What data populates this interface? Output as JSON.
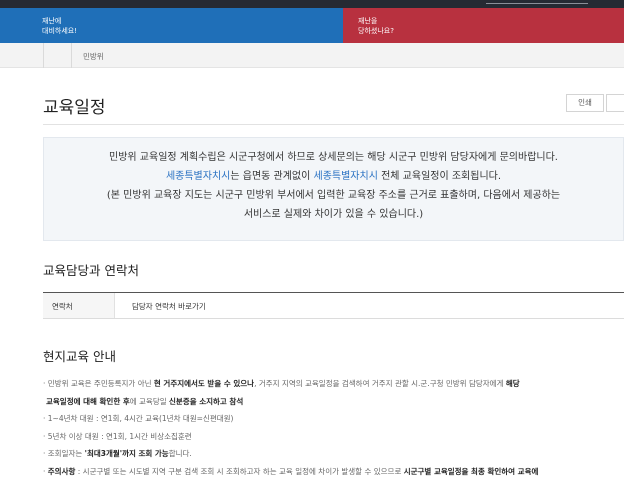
{
  "top_banners": {
    "left": {
      "line1": "재난에",
      "line2": "대비하세요!"
    },
    "right": {
      "line1": "재난을",
      "line2": "당하셨나요?"
    }
  },
  "breadcrumb": {
    "current": "민방위"
  },
  "page": {
    "title": "교육일정",
    "print_label": "인쇄"
  },
  "notice": {
    "line1": "민방위 교육일정 계획수립은 시군구청에서 하므로 상세문의는 해당 시군구 민방위 담당자에게 문의바랍니다.",
    "line2_part1": "세종특별자치시",
    "line2_part2": "는 읍면동 관계없이 ",
    "line2_part3": "세종특별자치시",
    "line2_part4": " 전체 교육일정이 조회됩니다.",
    "line3": "(본 민방위 교육장 지도는 시군구 민방위 부서에서 입력한 교육장 주소를 근거로 표출하며, 다음에서 제공하는",
    "line4": "서비스로 실제와 차이가 있을 수 있습니다.)"
  },
  "contact_section": {
    "heading": "교육담당과 연락처",
    "row_label": "연락처",
    "row_value": "담당자 연락처 바로가기"
  },
  "onsite_section": {
    "heading": "현지교육 안내",
    "item1": {
      "a": "· 민방위 교육은 주민등록지가 아닌 ",
      "b": "현 거주지에서도 받을 수 있으나",
      "c": ", 거주지 지역의 교육일정을 검색하여 거주지 관할 시.군.구청 민방위 담당자에게 ",
      "d": "해당",
      "e": "교육일정에 대해 확인한 후",
      "f": "에 교육당일 ",
      "g": "신분증을 소지하고 참석"
    },
    "item2": "· 1~4년차 대원 : 연1회, 4시간 교육(1년차 대원=신편대원)",
    "item3": "· 5년차 이상 대원 : 연1회, 1시간 비상소집훈련",
    "item4": {
      "a": "· 조회일자는 ",
      "b": "'최대3개월'까지 조회 가능",
      "c": "합니다."
    },
    "item5": {
      "a": "주의사항",
      "b": " : 시군구별 또는 시도별 지역 구분 검색 조회 시 조회하고자 하는 교육 일정에 차이가 발생할 수 있으므로 ",
      "c": "시군구별 교육일정을 최종 확인하여 교육에"
    }
  }
}
